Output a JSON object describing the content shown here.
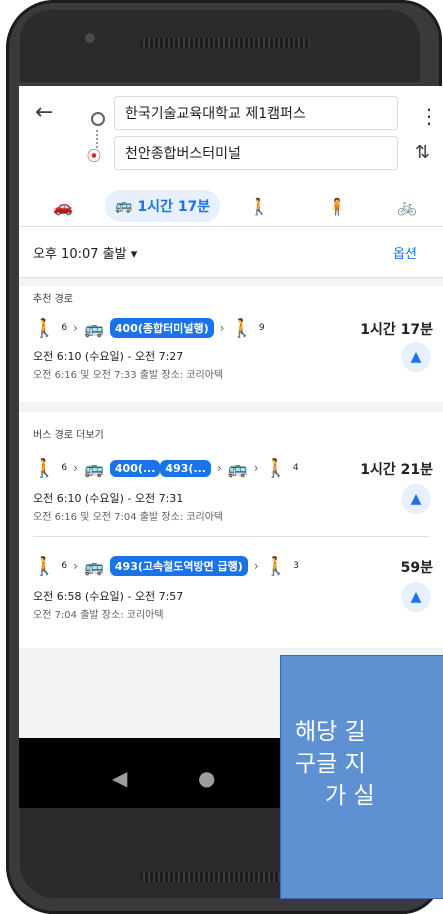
{
  "search": {
    "origin": "한국기술교육대학교 제1캠퍼스",
    "destination": "천안종합버스터미널"
  },
  "modes": {
    "active_transit_time": "1시간 17분"
  },
  "time_bar": {
    "departure": "오후 10:07 출발 ▾",
    "options": "옵션"
  },
  "recommended": {
    "title": "추천 경로",
    "route": {
      "walk1_min": "6",
      "bus_label": "400(종합터미널행)",
      "walk2_min": "9",
      "duration": "1시간 17분",
      "time_range": "오전 6:10 (수요일) - 오전 7:27",
      "alt_info": "오전 6:16 및 오전 7:33 출발 장소: 코리아텍"
    }
  },
  "more_routes": {
    "title": "버스 경로 더보기",
    "route1": {
      "walk1_min": "6",
      "bus_a": "400(...",
      "bus_b": "493(...",
      "walk2_min": "4",
      "duration": "1시간 21분",
      "time_range": "오전 6:10 (수요일) - 오전 7:31",
      "alt_info": "오전 6:16 및 오전 7:04 출발 장소: 코리아텍"
    },
    "route2": {
      "walk1_min": "6",
      "bus_label": "493(고속철도역방면 급행)",
      "walk2_min": "3",
      "duration": "59분",
      "time_range": "오전 6:58 (수요일) - 오전 7:57",
      "alt_info": "오전 7:04 출발 장소: 코리아텍"
    }
  },
  "overlay": {
    "line1": "해당 길",
    "line2": "구글 지",
    "line3": "가 실"
  },
  "colors": {
    "accent": "#1a73e8",
    "overlay": "#5e91d1"
  }
}
